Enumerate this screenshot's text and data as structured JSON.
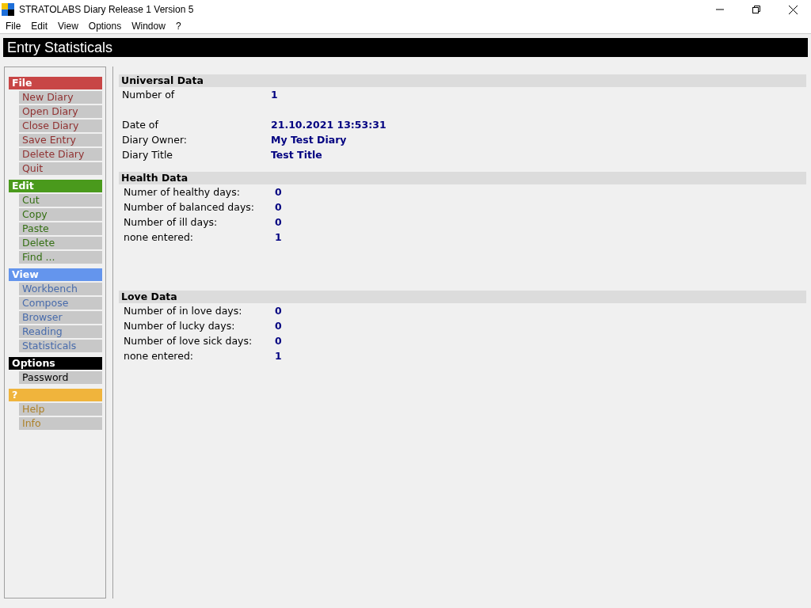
{
  "window": {
    "title": "STRATOLABS Diary Release 1 Version 5"
  },
  "menu_bar": [
    "File",
    "Edit",
    "View",
    "Options",
    "Window",
    "?"
  ],
  "page_title": "Entry Statisticals",
  "sidebar": {
    "sections": [
      {
        "title": "File",
        "color": "#c84646",
        "items": [
          "New Diary",
          "Open Diary",
          "Close Diary",
          "Save Entry",
          "Delete Diary",
          "Quit"
        ]
      },
      {
        "title": "Edit",
        "color": "#4a9a1c",
        "items": [
          "Cut",
          "Copy",
          "Paste",
          "Delete",
          "Find ..."
        ]
      },
      {
        "title": "View",
        "color": "#6495ed",
        "items": [
          "Workbench",
          "Compose",
          "Browser",
          "Reading",
          "Statisticals"
        ]
      },
      {
        "title": "Options",
        "color": "#000000",
        "items": [
          "Password"
        ]
      },
      {
        "title": "?",
        "color": "#f0b43c",
        "items": [
          "Help",
          "Info"
        ]
      }
    ]
  },
  "groups": [
    {
      "title": "Universal Data",
      "rows": [
        {
          "label": "Number of",
          "value": "1"
        },
        {
          "label": "Date of",
          "value": "21.10.2021 13:53:31"
        },
        {
          "label": "Diary Owner:",
          "value": "My Test Diary"
        },
        {
          "label": "Diary Title",
          "value": "Test Title"
        }
      ]
    },
    {
      "title": "Health Data",
      "rows": [
        {
          "label": "Numer of healthy days:",
          "value": "0"
        },
        {
          "label": "Number of balanced days:",
          "value": "0"
        },
        {
          "label": "Number of ill days:",
          "value": "0"
        },
        {
          "label": "none entered:",
          "value": "1"
        }
      ]
    },
    {
      "title": "Love Data",
      "rows": [
        {
          "label": "Number of in love days:",
          "value": "0"
        },
        {
          "label": "Number of lucky days:",
          "value": "0"
        },
        {
          "label": "Number of love sick days:",
          "value": "0"
        },
        {
          "label": "none entered:",
          "value": "1"
        }
      ]
    }
  ]
}
